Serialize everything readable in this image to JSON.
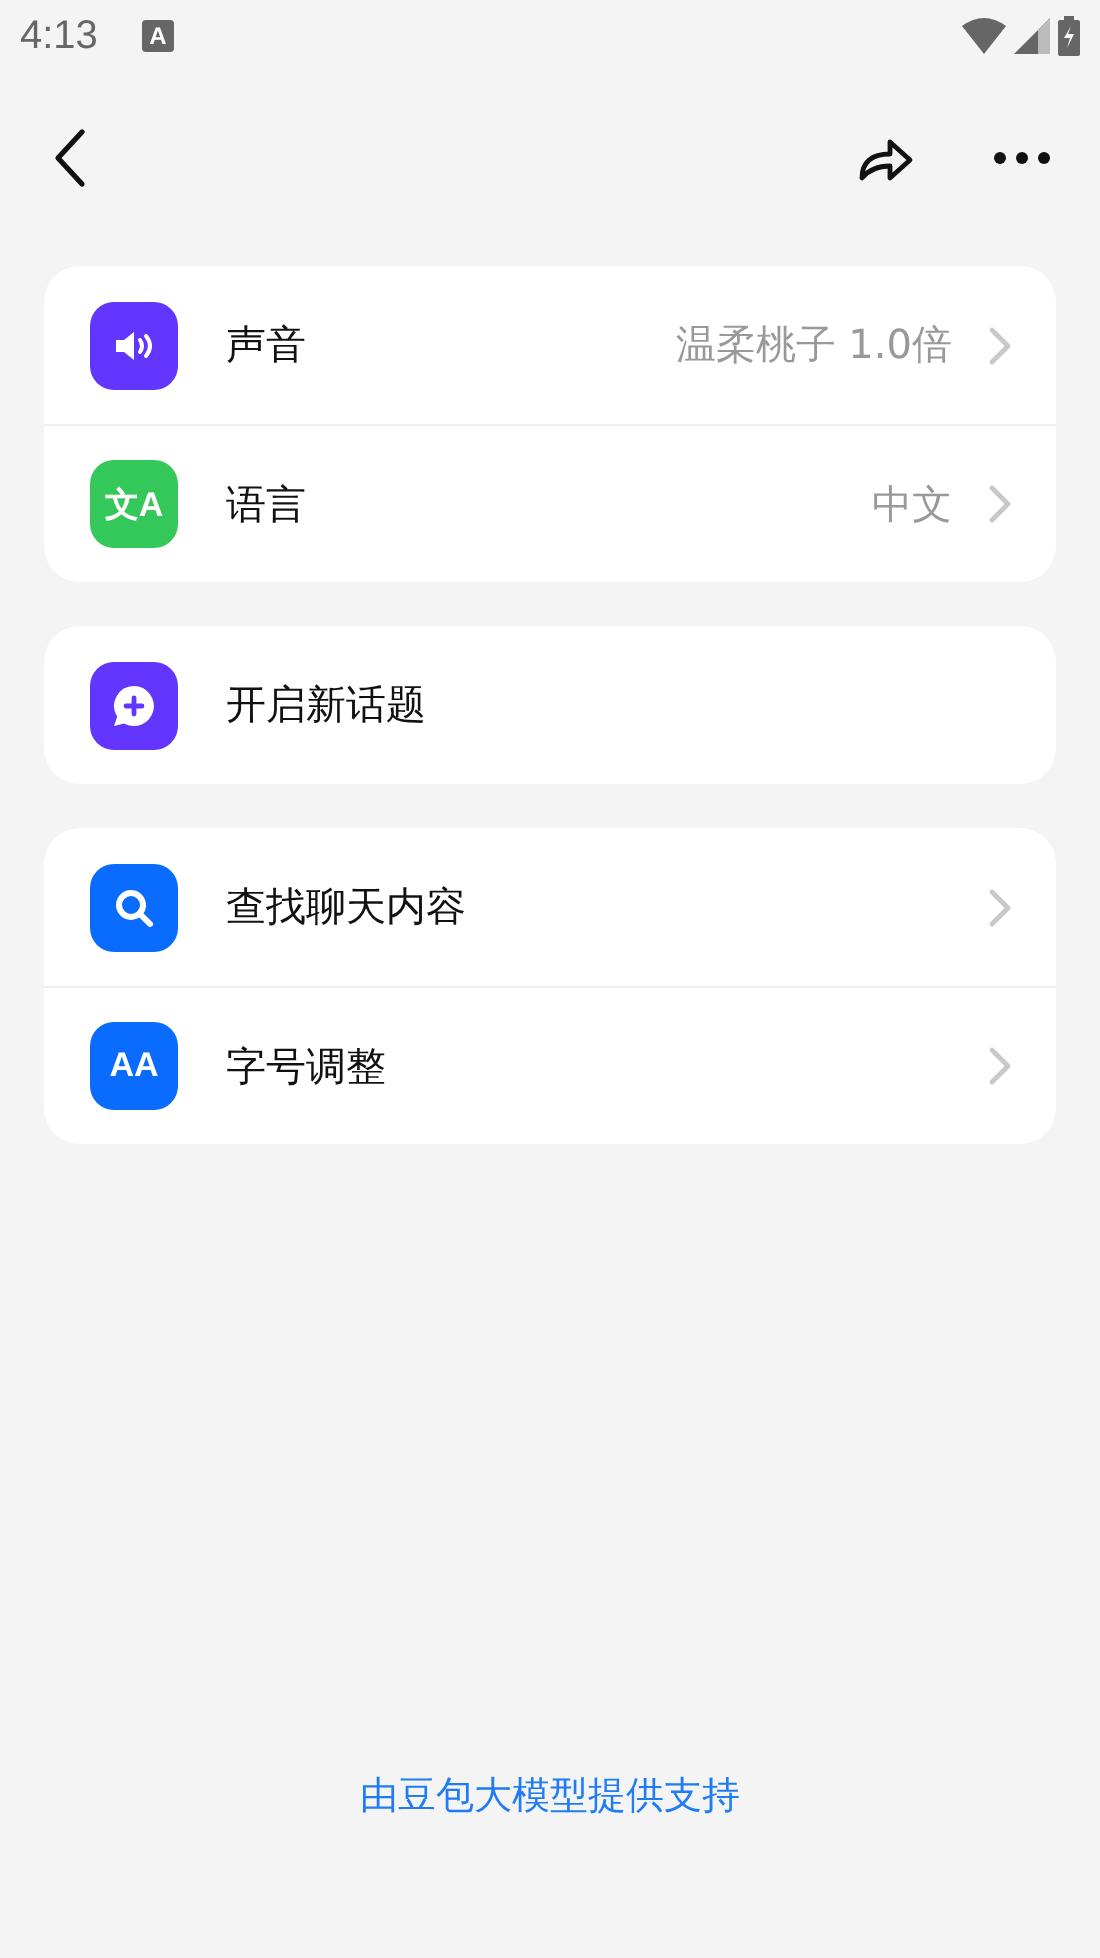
{
  "status_bar": {
    "time": "4:13",
    "notification_icon_text": "A"
  },
  "groups": [
    {
      "items": [
        {
          "label": "声音",
          "value": "温柔桃子 1.0倍",
          "kind": "speaker",
          "color": "#6236ff",
          "chevron": true
        },
        {
          "label": "语言",
          "value": "中文",
          "kind": "text",
          "icon_text": "文A",
          "color": "#34c759",
          "chevron": true
        }
      ]
    },
    {
      "items": [
        {
          "label": "开启新话题",
          "kind": "chat",
          "color": "#6236ff",
          "chevron": false
        }
      ]
    },
    {
      "items": [
        {
          "label": "查找聊天内容",
          "kind": "search",
          "color": "#0a6cff",
          "chevron": true
        },
        {
          "label": "字号调整",
          "kind": "text",
          "icon_text": "AA",
          "color": "#0a6cff",
          "chevron": true
        }
      ]
    }
  ],
  "footer": "由豆包大模型提供支持"
}
